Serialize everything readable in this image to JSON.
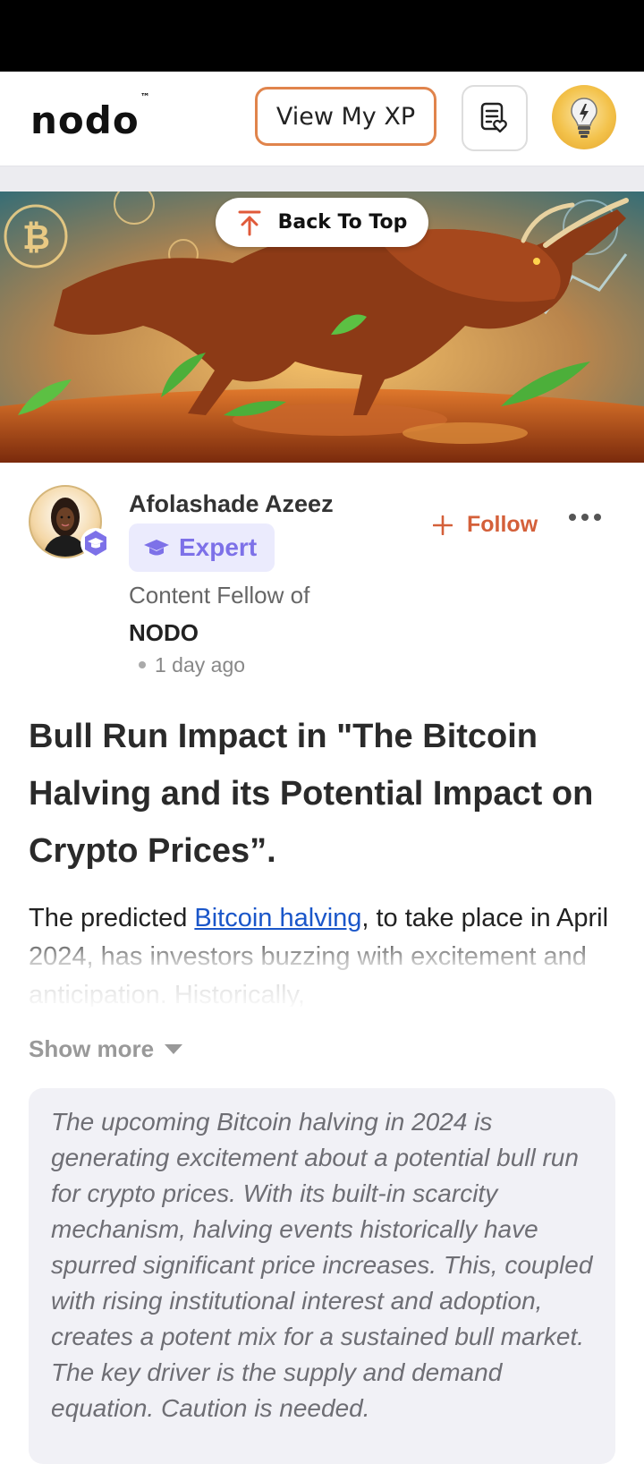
{
  "header": {
    "logo_text": "nodo",
    "logo_tm": "™",
    "xp_button_label": "View My XP"
  },
  "back_to_top_label": "Back To Top",
  "author": {
    "name": "Afolashade Azeez",
    "badge_label": "Expert",
    "fellow_text": "Content Fellow of",
    "organization": "NODO",
    "posted": "1 day ago",
    "follow_label": "Follow"
  },
  "article": {
    "title": "Bull Run Impact in \"The Bitcoin Halving and its Potential Impact on Crypto Prices”.",
    "intro_before_link": "The predicted ",
    "intro_link": "Bitcoin halving",
    "intro_after_link": ", to take place in April 2024, has investors buzzing with excitement and anticipation. Historically,",
    "show_more_label": "Show more",
    "summary": "The upcoming Bitcoin halving in 2024 is generating excitement about a potential bull run for crypto prices. With its built-in scarcity mechanism, halving events historically have spurred significant price increases. This, coupled with rising institutional interest and adoption, creates a potent mix for a sustained bull market. The key driver is the supply and demand equation. Caution is needed."
  },
  "colors": {
    "accent_orange": "#e0844c",
    "follow_red": "#d4603a",
    "expert_purple": "#7d71e8",
    "link_blue": "#1a56c9"
  }
}
